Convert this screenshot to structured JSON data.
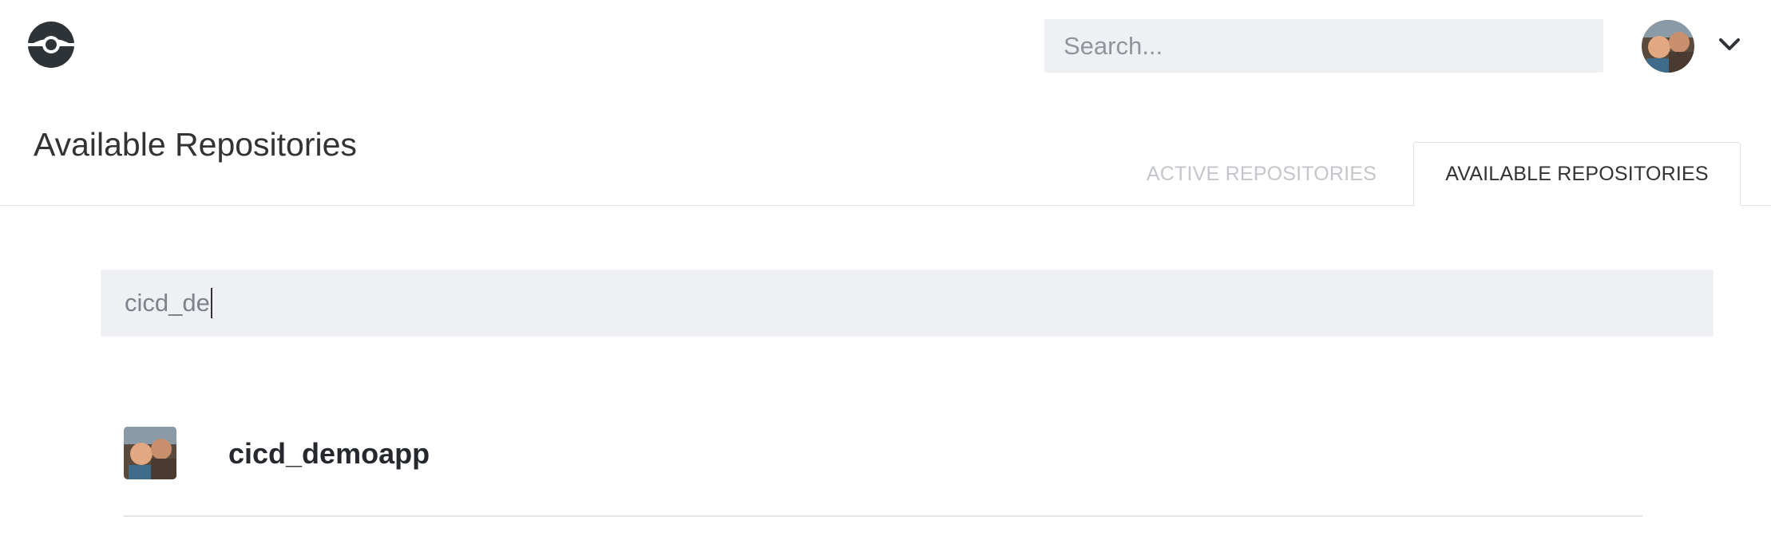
{
  "topbar": {
    "logo_icon": "drone-logo-icon",
    "search": {
      "placeholder": "Search...",
      "value": ""
    },
    "user_avatar_icon": "user-avatar-photo",
    "menu_icon": "chevron-down-icon"
  },
  "header": {
    "title": "Available Repositories",
    "tabs": [
      {
        "label": "ACTIVE REPOSITORIES",
        "active": false
      },
      {
        "label": "AVAILABLE REPOSITORIES",
        "active": true
      }
    ]
  },
  "filter": {
    "value": "cicd_de"
  },
  "repos": [
    {
      "name": "cicd_demoapp",
      "avatar_icon": "repo-owner-avatar"
    }
  ],
  "colors": {
    "input_bg": "#eff0f3",
    "inactive_tab": "#c3c6ca",
    "text": "#333333",
    "logo": "#2e3338"
  }
}
